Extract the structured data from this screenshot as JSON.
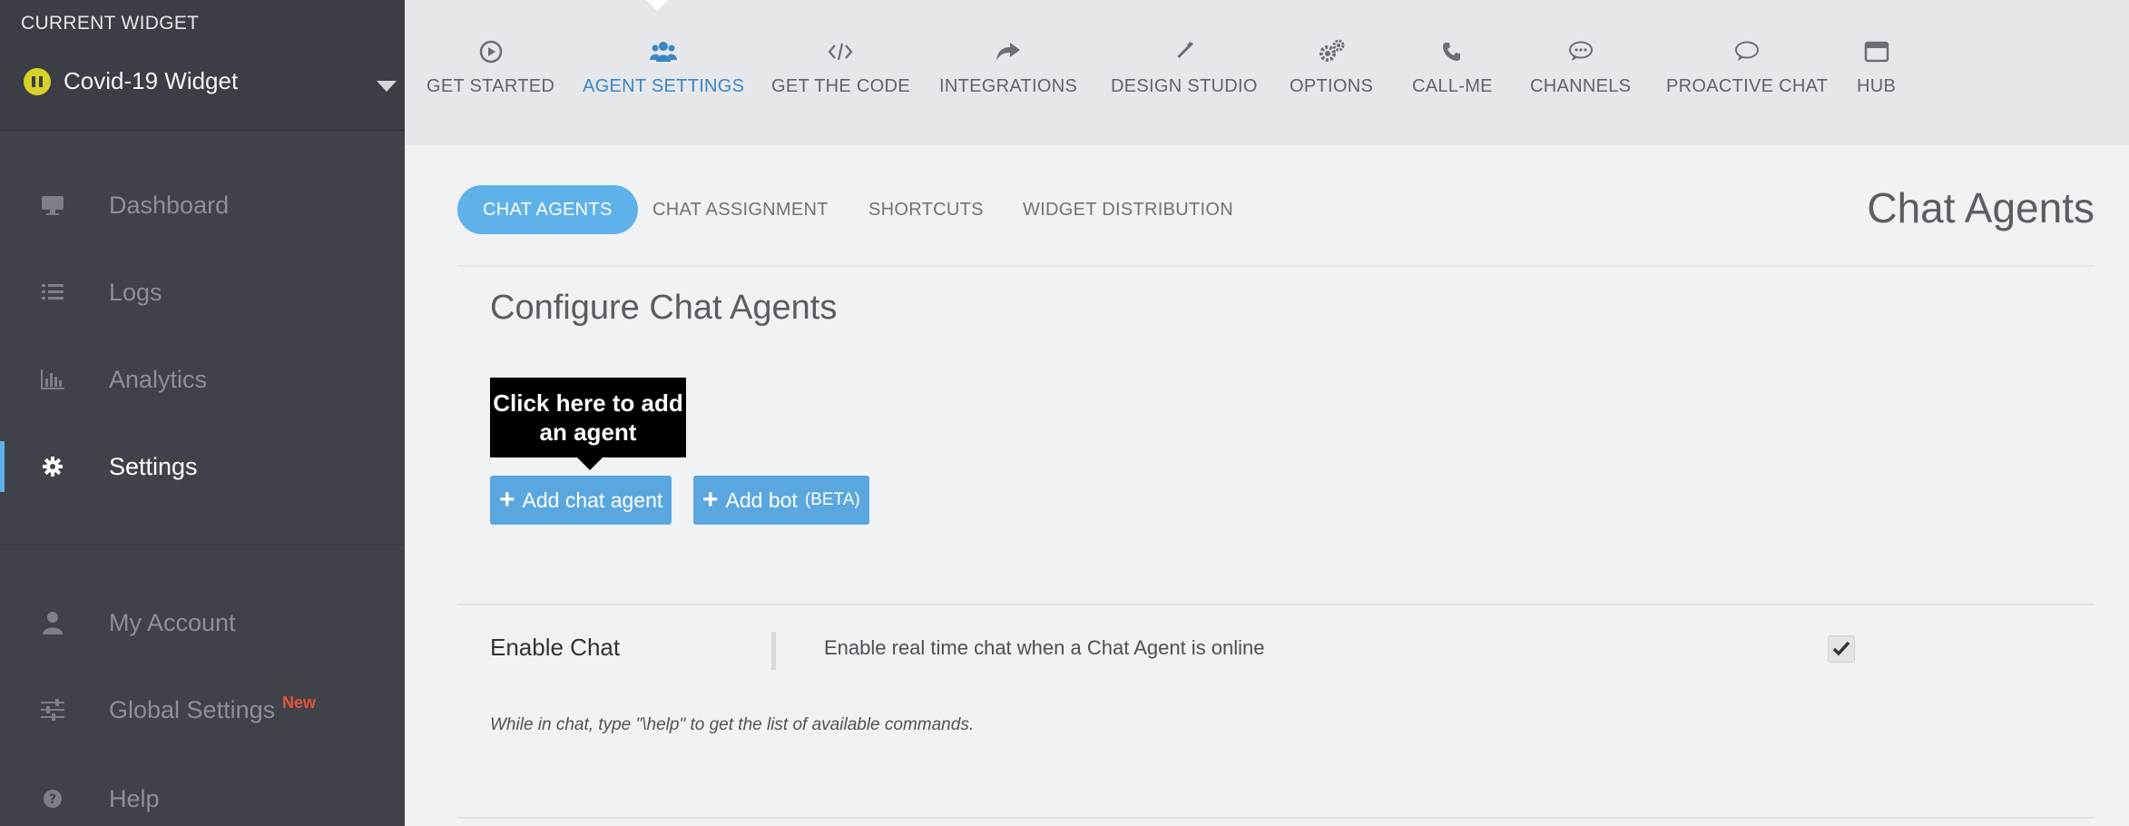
{
  "sidebar": {
    "widget_caption": "CURRENT WIDGET",
    "widget_name": "Covid-19 Widget",
    "widget_status_color": "#d8d12a",
    "items": [
      {
        "label": "Dashboard",
        "icon": "monitor-icon"
      },
      {
        "label": "Logs",
        "icon": "list-icon"
      },
      {
        "label": "Analytics",
        "icon": "bar-chart-icon"
      },
      {
        "label": "Settings",
        "icon": "gear-icon",
        "active": true
      },
      {
        "label": "My Account",
        "icon": "user-icon"
      },
      {
        "label": "Global Settings",
        "icon": "sliders-icon",
        "badge": "New"
      },
      {
        "label": "Help",
        "icon": "question-icon"
      }
    ]
  },
  "topnav": {
    "tabs": [
      {
        "label": "GET STARTED",
        "icon": "play-circle-icon"
      },
      {
        "label": "AGENT SETTINGS",
        "icon": "users-icon",
        "active": true
      },
      {
        "label": "GET THE CODE",
        "icon": "code-icon"
      },
      {
        "label": "INTEGRATIONS",
        "icon": "share-icon"
      },
      {
        "label": "DESIGN STUDIO",
        "icon": "magic-wand-icon"
      },
      {
        "label": "OPTIONS",
        "icon": "gears-icon"
      },
      {
        "label": "CALL-ME",
        "icon": "phone-icon"
      },
      {
        "label": "CHANNELS",
        "icon": "chat-bubble-dots-icon"
      },
      {
        "label": "PROACTIVE CHAT",
        "icon": "chat-bubble-icon"
      },
      {
        "label": "HUB",
        "icon": "window-icon"
      }
    ],
    "active_color": "#3a86c5"
  },
  "main": {
    "subtabs": [
      {
        "label": "CHAT AGENTS",
        "active": true
      },
      {
        "label": "CHAT ASSIGNMENT"
      },
      {
        "label": "SHORTCUTS"
      },
      {
        "label": "WIDGET DISTRIBUTION"
      }
    ],
    "page_heading": "Chat Agents",
    "section_title": "Configure Chat Agents",
    "tooltip": "Click here to add an agent",
    "add_agent_label": "Add chat agent",
    "add_bot_label": "Add bot",
    "add_bot_tag": "(BETA)",
    "enable_chat": {
      "label": "Enable Chat",
      "description": "Enable real time chat when a Chat Agent is online",
      "checked": true,
      "hint": "While in chat, type \"\\help\" to get the list of available commands."
    },
    "accent_color": "#5fb1ea"
  }
}
